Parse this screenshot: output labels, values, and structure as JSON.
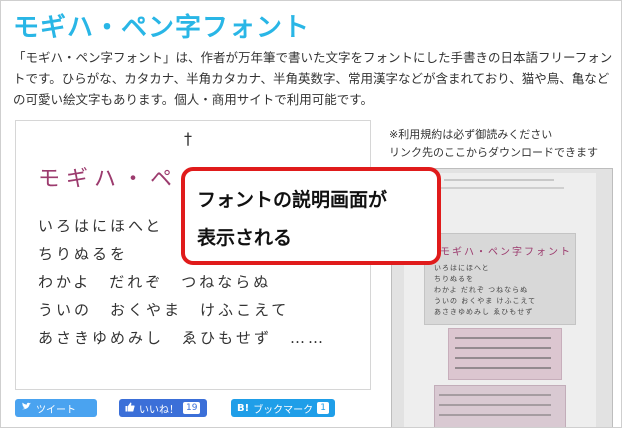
{
  "header": {
    "title": "モギハ・ペン字フォント"
  },
  "description": "「モギハ・ペン字フォント」は、作者が万年筆で書いた文字をフォントにした手書きの日本語フリーフォントです。ひらがな、カタカナ、半角カタカナ、半角英数字、常用漢字などが含まれており、猫や鳥、亀などの可愛い絵文字もあります。個人・商用サイトで利用可能です。",
  "preview": {
    "mark": "†",
    "title": "モギハ・ペ",
    "lines": [
      "いろはにほへと",
      "ちりぬるを",
      "わかよ　だれぞ　つねならぬ",
      "ういの　おくやま　けふこえて",
      "あさきゆめみし　ゑひもせず　……"
    ]
  },
  "notes": {
    "terms": "※利用規約は必ず御読みください",
    "link": "リンク先のここからダウンロードできます"
  },
  "screenshot": {
    "title": "モギハ・ペン字フォント",
    "lines": [
      "いろはにほへと",
      "ちりぬるを",
      "わかよ だれぞ つねならぬ",
      "ういの おくやま けふこえて",
      "あさきゆめみし ゑひもせず"
    ]
  },
  "callout": {
    "line1": "フォントの説明画面が",
    "line2": "表示される"
  },
  "share": {
    "twitter": {
      "icon": "bird-icon",
      "label": "ツイート"
    },
    "facebook": {
      "icon": "thumbs-up-icon",
      "label": "いいね！",
      "count": "19"
    },
    "hatena": {
      "icon": "B!",
      "label": "ブックマーク",
      "count": "1"
    }
  },
  "colors": {
    "title": "#29b6e6",
    "callout_border": "#e01b1b",
    "twitter": "#4aa3f0",
    "facebook": "#3b6fd8",
    "hatena": "#1f9ee8",
    "preview_title": "#9c3b6e"
  }
}
